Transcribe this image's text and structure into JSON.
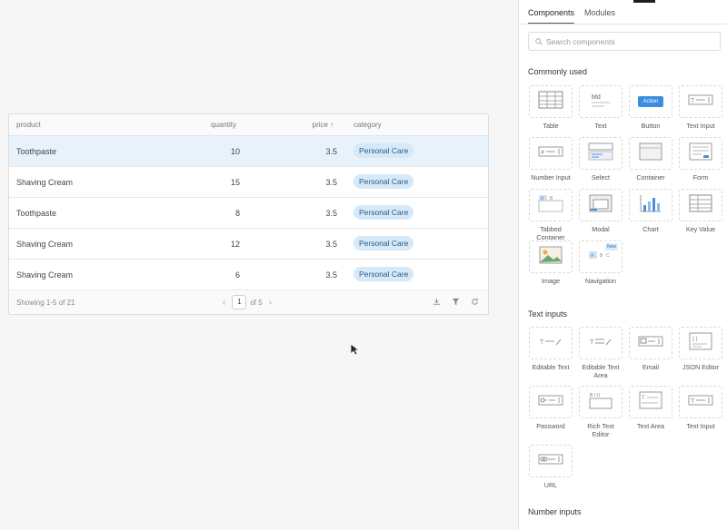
{
  "table": {
    "columns": {
      "product": "product",
      "quantity": "quantity",
      "price": "price",
      "category": "category"
    },
    "rows": [
      {
        "product": "Toothpaste",
        "quantity": "10",
        "price": "3.5",
        "category": "Personal Care",
        "selected": true
      },
      {
        "product": "Shaving Cream",
        "quantity": "15",
        "price": "3.5",
        "category": "Personal Care"
      },
      {
        "product": "Toothpaste",
        "quantity": "8",
        "price": "3.5",
        "category": "Personal Care"
      },
      {
        "product": "Shaving Cream",
        "quantity": "12",
        "price": "3.5",
        "category": "Personal Care"
      },
      {
        "product": "Shaving Cream",
        "quantity": "6",
        "price": "3.5",
        "category": "Personal Care"
      }
    ],
    "footer": {
      "showing": "Showing 1-5 of 21",
      "prev": "‹",
      "page": "1",
      "of_pages": "of 5",
      "next": "›"
    }
  },
  "panel": {
    "tabs": [
      "Components",
      "Modules"
    ],
    "search_placeholder": "Search components",
    "sections": {
      "commonly_used": "Commonly used",
      "text_inputs": "Text inputs",
      "number_inputs": "Number inputs"
    },
    "common": [
      "Table",
      "Text",
      "Button",
      "Text Input",
      "Number Input",
      "Select",
      "Container",
      "Form",
      "Tabbed Container",
      "Modal",
      "Chart",
      "Key Value",
      "Image",
      "Navigation"
    ],
    "button_tile_text": "Action",
    "new_badge": "New",
    "text_inputs": [
      "Editable Text",
      "Editable Text Area",
      "Email",
      "JSON Editor",
      "Password",
      "Rich Text Editor",
      "Text Area",
      "Text Input",
      "URL"
    ]
  }
}
